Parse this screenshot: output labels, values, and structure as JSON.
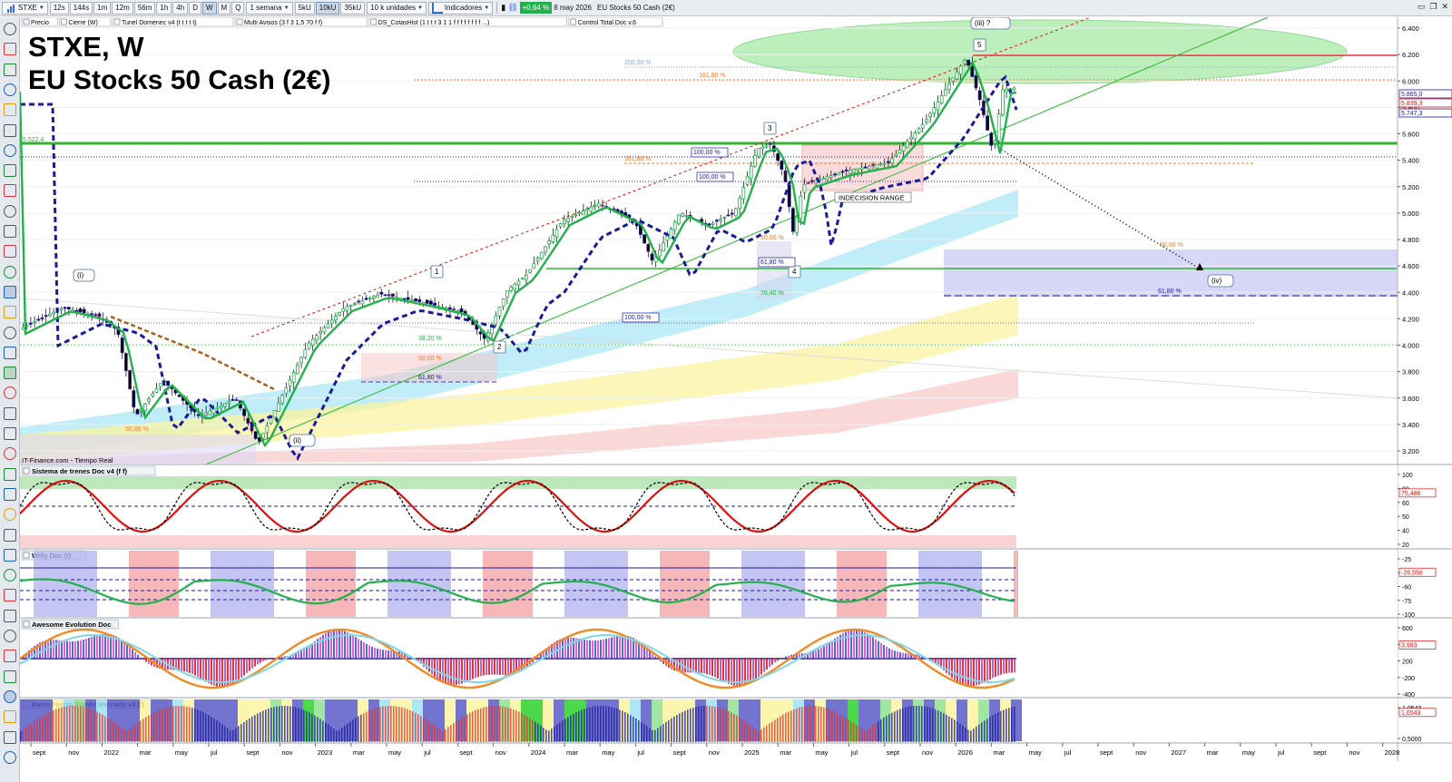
{
  "toolbar": {
    "symbol": "STXE",
    "intervals": [
      "12s",
      "144s",
      "1m",
      "12m",
      "56m",
      "1h",
      "4h",
      "D",
      "W",
      "M",
      "Q"
    ],
    "active_interval": "W",
    "period": "1 semana",
    "units": [
      "5kU",
      "10kU",
      "35kU"
    ],
    "active_unit": "10kU",
    "units_select": "10 k unidades",
    "indicators_label": "Indicadores",
    "change_pct": "+0,64 %",
    "date": "8 may 2026",
    "instrument": "EU Stocks 50 Cash (2€)"
  },
  "legend_tabs": [
    "Precio",
    "Cierre (W)",
    "Tunel Domenec v4 (t t t t t)",
    "Multi Avisos (3 f 3 1,5 70 f f)",
    "DS_CotasHist (1 t t t 3 1 1 f f f f f f f f ...)",
    "Control Total Doc v.6"
  ],
  "title": {
    "line1": "STXE, W",
    "line2": "EU Stocks 50 Cash (2€)"
  },
  "source_note": "IT-Finance.com - Tiempo Real",
  "colors": {
    "bullish": "#22b14c",
    "bearish": "#e01010",
    "trend_blue": "#1a1a9a",
    "level_green": "#2fb52f",
    "ellipse": "#7be07b",
    "cyan_band": "#9ee3f5",
    "yellow_band": "#fbf3a0",
    "pink_band": "#f9c7c7",
    "target_box": "#c9c9f4"
  },
  "price_axis": {
    "ticks": [
      "6.400",
      "6.200",
      "6.000",
      "5.800",
      "5.600",
      "5.400",
      "5.200",
      "5.000",
      "4.800",
      "4.600",
      "4.400",
      "4.200",
      "4.000",
      "3.800",
      "3.600",
      "3.400",
      "3.200"
    ],
    "badges": [
      {
        "text": "5.865,0",
        "color": "#1a1a9a"
      },
      {
        "text": "5.839,3",
        "color": "#e01010"
      },
      {
        "text": "5.747,3",
        "color": "#1a1a9a"
      }
    ]
  },
  "level_label": "5.522,4",
  "wave_labels": [
    "(i)",
    "(ii)",
    "(iii) ?",
    "(iv)",
    "1",
    "2",
    "3",
    "4",
    "5"
  ],
  "fib_labels": [
    {
      "text": "200,00 %",
      "color": "#8ea6c8"
    },
    {
      "text": "161,80 %",
      "color": "#f07a2e"
    },
    {
      "text": "161,80 %",
      "color": "#f07a2e"
    },
    {
      "text": "100,00 %",
      "color": "#1a1aa0"
    },
    {
      "text": "100,00 %",
      "color": "#1a1aa0"
    },
    {
      "text": "100,00 %",
      "color": "#1a1aa0"
    },
    {
      "text": "50,00 %",
      "color": "#f07a2e"
    },
    {
      "text": "61,80 %",
      "color": "#1a1aa0"
    },
    {
      "text": "78,40 %",
      "color": "#22b14c"
    },
    {
      "text": "38,20 %",
      "color": "#22b14c"
    },
    {
      "text": "50,00 %",
      "color": "#f07a2e"
    },
    {
      "text": "61,80 %",
      "color": "#1a1aa0"
    },
    {
      "text": "50,00 %",
      "color": "#f07a2e"
    },
    {
      "text": "50,00 %",
      "color": "#f07a2e"
    },
    {
      "text": "61,80 %",
      "color": "#1a1aa0"
    }
  ],
  "range_label": "INDECISION RANGE",
  "panes": [
    {
      "title": "Sistema de trenes Doc v4 (f f)",
      "ticks": [
        "100",
        "80",
        "60",
        "50",
        "40",
        "20"
      ],
      "badge": "75,486"
    },
    {
      "title": "Willy Doc (t)",
      "ticks": [
        "-25",
        "-50",
        "-60",
        "-75",
        "-100"
      ],
      "badge": "-26,556"
    },
    {
      "title": "Awesome Evolution Doc",
      "ticks": [
        "600",
        "400",
        "200",
        "-200",
        "-400"
      ],
      "badge": "3,983"
    },
    {
      "title": "Barra Fuerza Fondo Mercado v4 (f)",
      "ticks": [
        "1,0543",
        "0,5000"
      ],
      "badge": "1,0543"
    }
  ],
  "time_axis": [
    "sept",
    "nov",
    "2022",
    "mar",
    "may",
    "jul",
    "sept",
    "nov",
    "2023",
    "mar",
    "may",
    "jul",
    "sept",
    "nov",
    "2024",
    "mar",
    "may",
    "jul",
    "sept",
    "nov",
    "2025",
    "mar",
    "may",
    "jul",
    "sept",
    "nov",
    "2026",
    "mar",
    "may",
    "jul",
    "sept",
    "nov",
    "2027",
    "mar",
    "may",
    "jul",
    "sept",
    "nov",
    "2028"
  ]
}
